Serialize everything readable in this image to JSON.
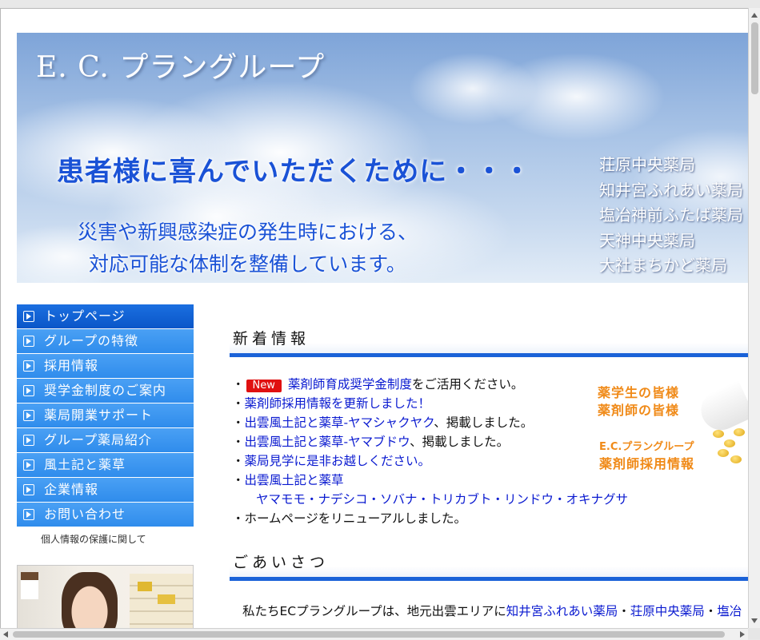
{
  "banner": {
    "title": "E. C. プラングループ",
    "catch": "患者様に喜んでいただくために・・・",
    "sub1": "災害や新興感染症の発生時における、",
    "sub2": "対応可能な体制を整備しています。",
    "pharmacies": [
      "荘原中央薬局",
      "知井宮ふれあい薬局",
      "塩冶神前ふたば薬局",
      "天神中央薬局",
      "大社まちかど薬局"
    ]
  },
  "nav": {
    "items": [
      "トップページ",
      "グループの特徴",
      "採用情報",
      "奨学金制度のご案内",
      "薬局開業サポート",
      "グループ薬局紹介",
      "風土記と薬草",
      "企業情報",
      "お問い合わせ"
    ],
    "privacy": "個人情報の保護に関して"
  },
  "news": {
    "title": "新着情報",
    "badge": "New",
    "bullet": "・",
    "item1_link": "薬剤師育成奨学金制度",
    "item1_text": "をご活用ください。",
    "item2_link": "薬剤師採用情報を更新しました！",
    "item3_link": "出雲風土記と薬草-ヤマシャクヤク",
    "item3_text": "、掲載しました。",
    "item4_link": "出雲風土記と薬草-ヤマブドウ",
    "item4_text": "、掲載しました。",
    "item5_link": "薬局見学に是非お越しください。",
    "item6_link": "出雲風土記と薬草",
    "item6_sub": "ヤマモモ・ナデシコ・ソバナ・トリカブト・リンドウ・オキナグサ",
    "item7_text": "ホームページをリニューアルしました。"
  },
  "recruit": {
    "line1": "薬学生の皆様",
    "line2": "薬剤師の皆様",
    "line3": "E.C.プラングループ",
    "line4": "薬剤師採用情報"
  },
  "greeting": {
    "title": "ごあいさつ",
    "text": "私たちECプラングループは、地元出雲エリアに",
    "link1": "知井宮ふれあい薬局",
    "sep": "・",
    "link2": "荘原中央薬局",
    "link3": "塩冶"
  },
  "colors": {
    "accent": "#1a62d8",
    "nav": "#3390ee",
    "link": "#0a1ad0",
    "recruit": "#f08a18",
    "new_badge": "#e01010"
  }
}
